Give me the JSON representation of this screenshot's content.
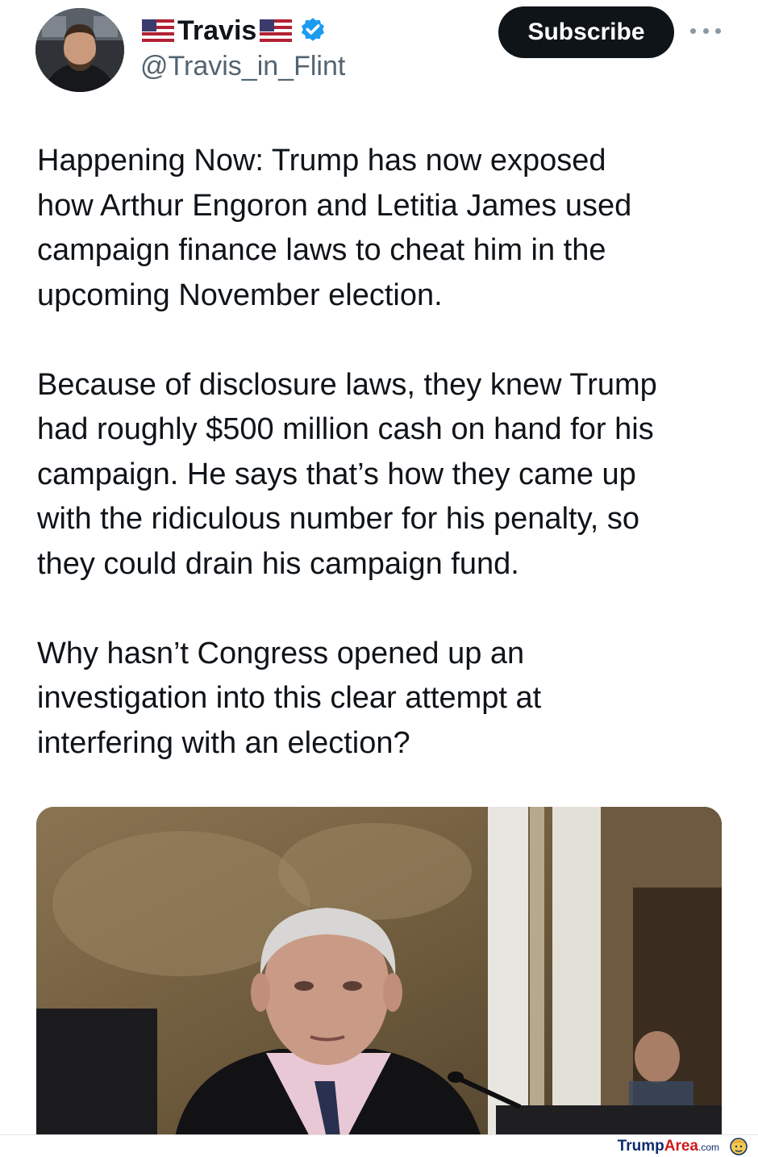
{
  "post": {
    "author": {
      "display_name": "Travis",
      "handle": "@Travis_in_Flint",
      "verified": true
    },
    "actions": {
      "subscribe_label": "Subscribe",
      "more_icon": "more-horizontal-icon"
    },
    "paragraphs": [
      "Happening Now:  Trump has now exposed\nhow Arthur Engoron and Letitia James used\ncampaign finance laws to cheat him in the\nupcoming November election.",
      "Because of disclosure laws, they knew Trump\nhad roughly $500 million cash on hand for his\ncampaign.  He says that’s how they came up\nwith the ridiculous number for his penalty, so\nthey could drain his campaign fund.",
      "Why hasn’t Congress opened up an\ninvestigation into this clear attempt at\ninterfering with an election?"
    ]
  },
  "watermark": {
    "brand_part1": "Trump",
    "brand_part2": "Area",
    "brand_suffix": ".com"
  },
  "colors": {
    "text_primary": "#0f1419",
    "text_secondary": "#536471",
    "button_bg": "#0f1419",
    "verified_blue": "#1d9bf0",
    "watermark_blue": "#0d2c6c",
    "watermark_red": "#cc1c1c"
  }
}
